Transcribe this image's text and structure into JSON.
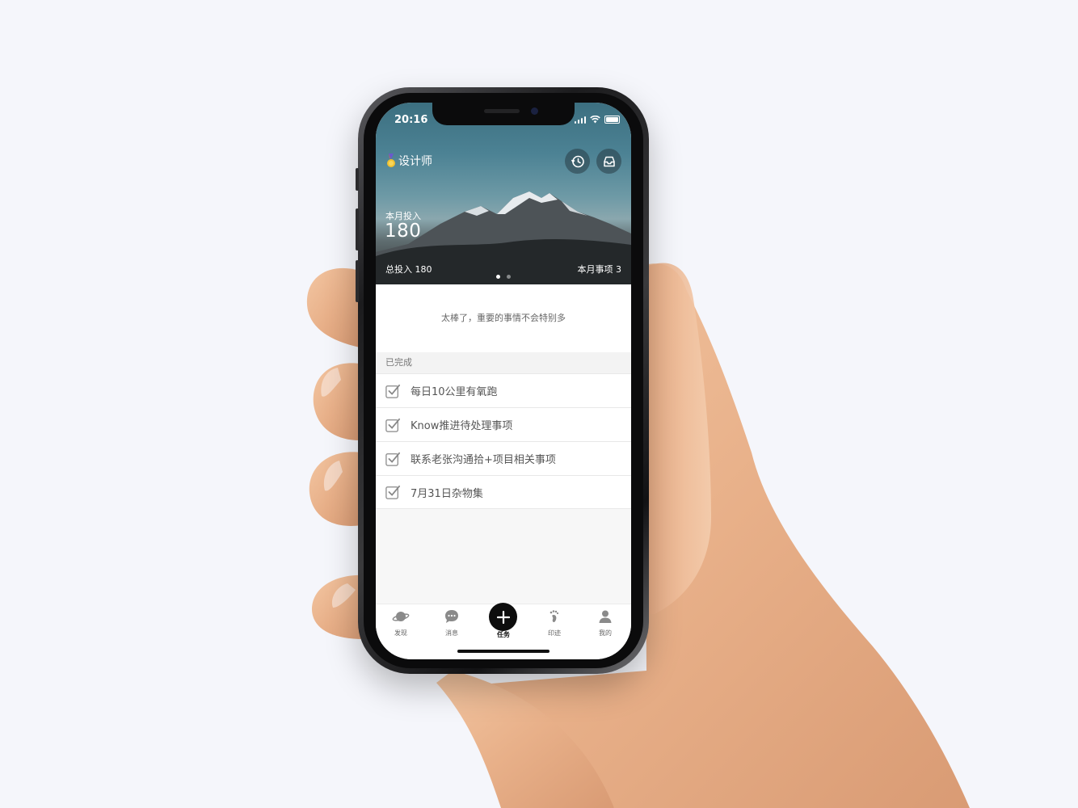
{
  "status_bar": {
    "time": "20:16"
  },
  "header": {
    "role": "设计师",
    "month_input_label": "本月投入",
    "month_input_value": "180",
    "total_input": "总投入  180",
    "month_items": "本月事项  3",
    "history_icon": "history-icon",
    "inbox_icon": "inbox-icon"
  },
  "message": "太棒了，重要的事情不会特别多",
  "completed_section": {
    "title": "已完成",
    "tasks": [
      {
        "label": "每日10公里有氧跑",
        "checked": true
      },
      {
        "label": "Know推进待处理事项",
        "checked": true
      },
      {
        "label": "联系老张沟通拾+项目相关事项",
        "checked": true
      },
      {
        "label": "7月31日杂物集",
        "checked": true
      }
    ]
  },
  "tabbar": {
    "items": [
      {
        "label": "发现",
        "icon": "planet-icon"
      },
      {
        "label": "消息",
        "icon": "chat-icon"
      },
      {
        "label": "任务",
        "icon": "plus-icon",
        "active": true
      },
      {
        "label": "印迹",
        "icon": "footprint-icon"
      },
      {
        "label": "我的",
        "icon": "user-icon"
      }
    ]
  },
  "colors": {
    "accent": "#0d0d0d",
    "header_sky": "#4c8294",
    "background": "#f5f6fb"
  }
}
